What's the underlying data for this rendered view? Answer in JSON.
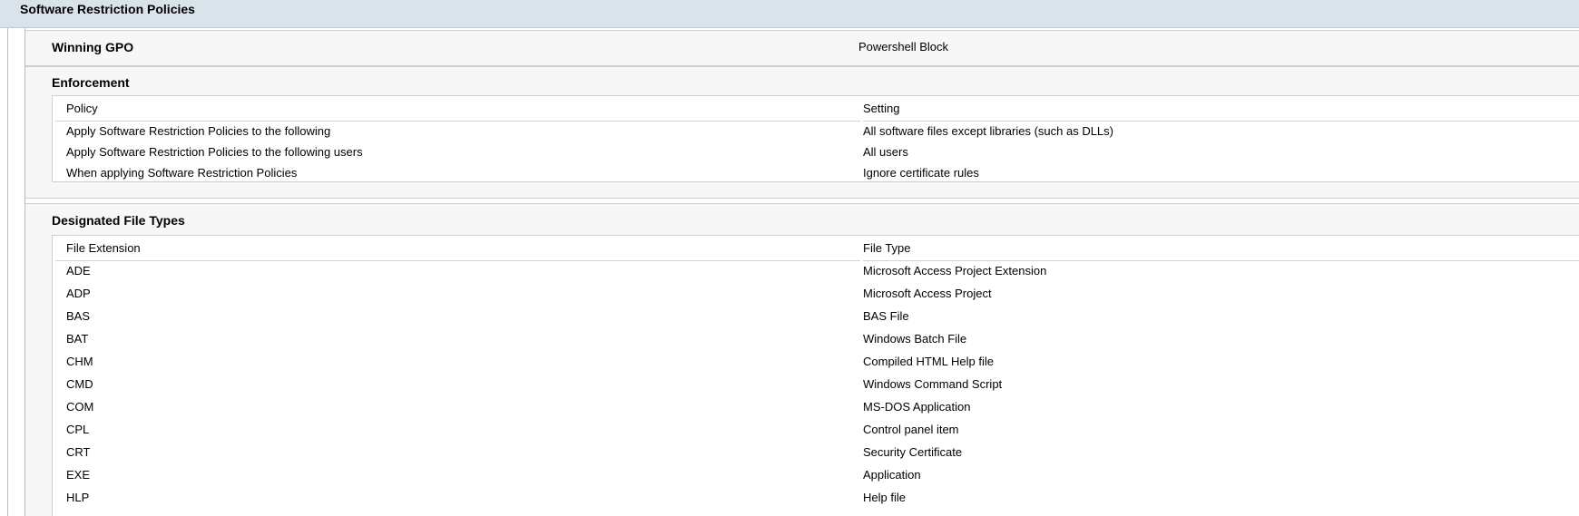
{
  "section": {
    "title": "Software Restriction Policies"
  },
  "winning_gpo": {
    "label": "Winning GPO",
    "value": "Powershell Block"
  },
  "enforcement": {
    "title": "Enforcement",
    "columns": [
      "Policy",
      "Setting"
    ],
    "rows": [
      [
        "Apply Software Restriction Policies to the following",
        "All software files except libraries (such as DLLs)"
      ],
      [
        "Apply Software Restriction Policies to the following users",
        "All users"
      ],
      [
        "When applying Software Restriction Policies",
        "Ignore certificate rules"
      ]
    ]
  },
  "file_types": {
    "title": "Designated File Types",
    "columns": [
      "File Extension",
      "File Type"
    ],
    "rows": [
      [
        "ADE",
        "Microsoft Access Project Extension"
      ],
      [
        "ADP",
        "Microsoft Access Project"
      ],
      [
        "BAS",
        "BAS File"
      ],
      [
        "BAT",
        "Windows Batch File"
      ],
      [
        "CHM",
        "Compiled HTML Help file"
      ],
      [
        "CMD",
        "Windows Command Script"
      ],
      [
        "COM",
        "MS-DOS Application"
      ],
      [
        "CPL",
        "Control panel item"
      ],
      [
        "CRT",
        "Security Certificate"
      ],
      [
        "EXE",
        "Application"
      ],
      [
        "HLP",
        "Help file"
      ]
    ]
  }
}
